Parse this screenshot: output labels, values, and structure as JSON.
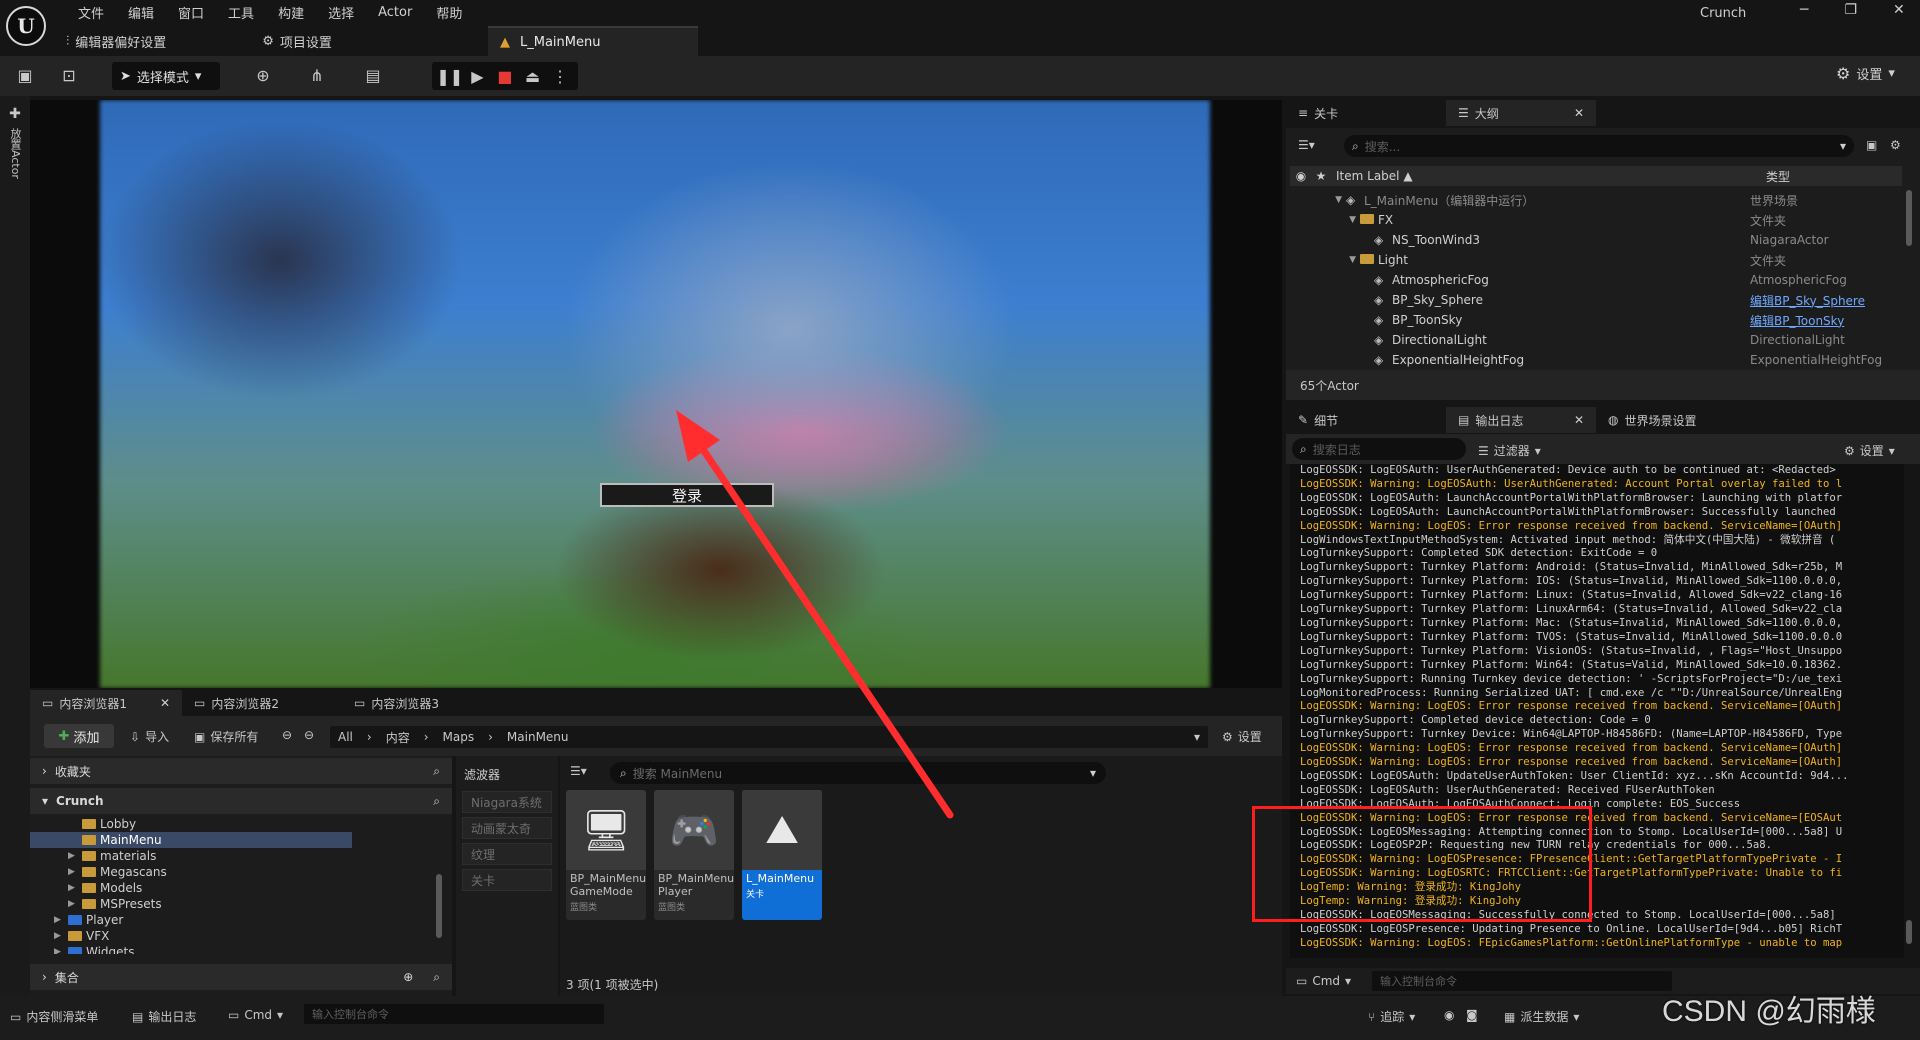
{
  "menu": [
    "文件",
    "编辑",
    "窗口",
    "工具",
    "构建",
    "选择",
    "Actor",
    "帮助"
  ],
  "top_buttons": [
    {
      "label": "编辑器偏好设置",
      "icon": "sliders-icon"
    },
    {
      "label": "项目设置",
      "icon": "gear-icon"
    }
  ],
  "doc_tab": "L_MainMenu",
  "app_name": "Crunch",
  "window_controls": [
    "─",
    "❐",
    "✕"
  ],
  "toolbar": {
    "mode": "选择模式",
    "settings": "设置"
  },
  "left_strip": "放置Actor",
  "viewport": {
    "login_button": "登录"
  },
  "content_browser": {
    "tabs": [
      "内容浏览器1",
      "内容浏览器2",
      "内容浏览器3"
    ],
    "add": "添加",
    "import": "导入",
    "save_all": "保存所有",
    "breadcrumb": [
      "All",
      "内容",
      "Maps",
      "MainMenu"
    ],
    "settings": "设置",
    "favorites": "收藏夹",
    "project": "Crunch",
    "tree": [
      {
        "label": "Lobby",
        "depth": 2,
        "selected": false,
        "color": "yellow"
      },
      {
        "label": "MainMenu",
        "depth": 2,
        "selected": true,
        "color": "yellow"
      },
      {
        "label": "materials",
        "depth": 2,
        "selected": false,
        "color": "yellow"
      },
      {
        "label": "Megascans",
        "depth": 2,
        "selected": false,
        "color": "yellow"
      },
      {
        "label": "Models",
        "depth": 2,
        "selected": false,
        "color": "yellow"
      },
      {
        "label": "MSPresets",
        "depth": 2,
        "selected": false,
        "color": "yellow"
      },
      {
        "label": "Player",
        "depth": 1,
        "selected": false,
        "color": "blue"
      },
      {
        "label": "VFX",
        "depth": 1,
        "selected": false,
        "color": "yellow"
      },
      {
        "label": "Widgets",
        "depth": 1,
        "selected": false,
        "color": "blue"
      }
    ],
    "collections": "集合",
    "filters_title": "滤波器",
    "filters": [
      "Niagara系统",
      "动画蒙太奇",
      "纹理",
      "关卡"
    ],
    "search_placeholder": "搜索 MainMenu",
    "assets": [
      {
        "name": "BP_MainMenu GameMode",
        "type": "蓝图类",
        "icon": "monitor-gamepad-icon",
        "selected": false
      },
      {
        "name": "BP_MainMenu Player",
        "type": "蓝图类",
        "icon": "gamepad-icon",
        "selected": false
      },
      {
        "name": "L_MainMenu",
        "type": "关卡",
        "icon": "level-icon",
        "selected": true
      }
    ],
    "count": "3 项(1 项被选中)"
  },
  "status_bar": {
    "content_drawer": "内容侧滑菜单",
    "output_log": "输出日志",
    "cmd": "Cmd",
    "cmd_placeholder": "输入控制台命令",
    "trace": "追踪",
    "derived": "派生数据"
  },
  "outliner": {
    "tab_level": "关卡",
    "tab_outline": "大纲",
    "search_placeholder": "搜索...",
    "col_label": "Item Label ▲",
    "col_type": "类型",
    "rows": [
      {
        "label": "L_MainMenu（编辑器中运行）",
        "type": "世界场景",
        "indent": 0,
        "dim": true,
        "link": false
      },
      {
        "label": "FX",
        "type": "文件夹",
        "indent": 1,
        "dim": false,
        "link": false
      },
      {
        "label": "NS_ToonWind3",
        "type": "NiagaraActor",
        "indent": 2,
        "dim": false,
        "link": false
      },
      {
        "label": "Light",
        "type": "文件夹",
        "indent": 1,
        "dim": false,
        "link": false
      },
      {
        "label": "AtmosphericFog",
        "type": "AtmosphericFog",
        "indent": 2,
        "dim": false,
        "link": false
      },
      {
        "label": "BP_Sky_Sphere",
        "type": "编辑BP_Sky_Sphere",
        "indent": 2,
        "dim": false,
        "link": true
      },
      {
        "label": "BP_ToonSky",
        "type": "编辑BP_ToonSky",
        "indent": 2,
        "dim": false,
        "link": true
      },
      {
        "label": "DirectionalLight",
        "type": "DirectionalLight",
        "indent": 2,
        "dim": false,
        "link": false
      },
      {
        "label": "ExponentialHeightFog",
        "type": "ExponentialHeightFog",
        "indent": 2,
        "dim": false,
        "link": false
      }
    ],
    "footer": "65个Actor"
  },
  "log_panel": {
    "tab_details": "细节",
    "tab_log": "输出日志",
    "tab_world": "世界场景设置",
    "search_placeholder": "搜索日志",
    "filter": "过滤器",
    "settings": "设置",
    "cmd": "Cmd",
    "cmd_placeholder": "输入控制台命令",
    "lines": [
      {
        "t": "LogEOSSDK: LogEOSAuth: UserAuthGenerated: Device auth to be continued at: <Redacted>",
        "w": false
      },
      {
        "t": "LogEOSSDK: Warning: LogEOSAuth: UserAuthGenerated: Account Portal overlay failed to l",
        "w": true
      },
      {
        "t": "LogEOSSDK: LogEOSAuth: LaunchAccountPortalWithPlatformBrowser: Launching with platfor",
        "w": false
      },
      {
        "t": "LogEOSSDK: LogEOSAuth: LaunchAccountPortalWithPlatformBrowser: Successfully launched",
        "w": false
      },
      {
        "t": "LogEOSSDK: Warning: LogEOS: Error response received from backend. ServiceName=[OAuth]",
        "w": true
      },
      {
        "t": "LogWindowsTextInputMethodSystem: Activated input method: 简体中文(中国大陆) - 微软拼音 (",
        "w": false
      },
      {
        "t": "LogTurnkeySupport: Completed SDK detection: ExitCode = 0",
        "w": false
      },
      {
        "t": "LogTurnkeySupport: Turnkey Platform: Android: (Status=Invalid, MinAllowed_Sdk=r25b, M",
        "w": false
      },
      {
        "t": "LogTurnkeySupport: Turnkey Platform: IOS: (Status=Invalid, MinAllowed_Sdk=1100.0.0.0,",
        "w": false
      },
      {
        "t": "LogTurnkeySupport: Turnkey Platform: Linux: (Status=Invalid, Allowed_Sdk=v22_clang-16",
        "w": false
      },
      {
        "t": "LogTurnkeySupport: Turnkey Platform: LinuxArm64: (Status=Invalid, Allowed_Sdk=v22_cla",
        "w": false
      },
      {
        "t": "LogTurnkeySupport: Turnkey Platform: Mac: (Status=Invalid, MinAllowed_Sdk=1100.0.0.0,",
        "w": false
      },
      {
        "t": "LogTurnkeySupport: Turnkey Platform: TVOS: (Status=Invalid, MinAllowed_Sdk=1100.0.0.0",
        "w": false
      },
      {
        "t": "LogTurnkeySupport: Turnkey Platform: VisionOS: (Status=Invalid, , Flags=\"Host_Unsuppo",
        "w": false
      },
      {
        "t": "LogTurnkeySupport: Turnkey Platform: Win64: (Status=Valid, MinAllowed_Sdk=10.0.18362.",
        "w": false
      },
      {
        "t": "LogTurnkeySupport: Running Turnkey device detection: ' -ScriptsForProject=\"D:/ue_texi",
        "w": false
      },
      {
        "t": "LogMonitoredProcess: Running Serialized UAT: [ cmd.exe /c \"\"D:/UnrealSource/UnrealEng",
        "w": false
      },
      {
        "t": "LogEOSSDK: Warning: LogEOS: Error response received from backend. ServiceName=[OAuth]",
        "w": true
      },
      {
        "t": "LogTurnkeySupport: Completed device detection: Code = 0",
        "w": false
      },
      {
        "t": "LogTurnkeySupport: Turnkey Device: Win64@LAPTOP-H84586FD: (Name=LAPTOP-H84586FD, Type",
        "w": false
      },
      {
        "t": "LogEOSSDK: Warning: LogEOS: Error response received from backend. ServiceName=[OAuth]",
        "w": true
      },
      {
        "t": "LogEOSSDK: Warning: LogEOS: Error response received from backend. ServiceName=[OAuth]",
        "w": true
      },
      {
        "t": "LogEOSSDK: LogEOSAuth: UpdateUserAuthToken: User ClientId: xyz...sKn AccountId: 9d4...",
        "w": false
      },
      {
        "t": "LogEOSSDK: LogEOSAuth: UserAuthGenerated: Received FUserAuthToken",
        "w": false
      },
      {
        "t": "LogEOSSDK: LogEOSAuth: LogEOSAuthConnect: Login complete: EOS_Success",
        "w": false
      },
      {
        "t": "LogEOSSDK: Warning: LogEOS: Error response received from backend. ServiceName=[EOSAut",
        "w": true
      },
      {
        "t": "LogEOSSDK: LogEOSMessaging: Attempting connection to Stomp. LocalUserId=[000...5a8] U",
        "w": false
      },
      {
        "t": "LogEOSSDK: LogEOSP2P: Requesting new TURN relay credentials for 000...5a8.",
        "w": false
      },
      {
        "t": "LogEOSSDK: Warning: LogEOSPresence: FPresenceClient::GetTargetPlatformTypePrivate - I",
        "w": true
      },
      {
        "t": "LogEOSSDK: Warning: LogEOSRTC: FRTCClient::GetTargetPlatformTypePrivate: Unable to fi",
        "w": true
      },
      {
        "t": "LogTemp: Warning: 登录成功: KingJohy",
        "w": true
      },
      {
        "t": "LogTemp: Warning: 登录成功: KingJohy",
        "w": true
      },
      {
        "t": "LogEOSSDK: LogEOSMessaging: Successfully connected to Stomp. LocalUserId=[000...5a8]",
        "w": false
      },
      {
        "t": "LogEOSSDK: LogEOSPresence: Updating Presence to Online. LocalUserId=[9d4...b05] RichT",
        "w": false
      },
      {
        "t": "LogEOSSDK: Warning: LogEOS: FEpicGamesPlatform::GetOnlinePlatformType - unable to map",
        "w": true
      }
    ]
  },
  "watermark": "CSDN @幻雨様",
  "colors": {
    "accent": "#0f6fd6",
    "warning": "#f0b21b",
    "highlight_box": "#ff1e1e",
    "arrow": "#ff2d2d"
  }
}
